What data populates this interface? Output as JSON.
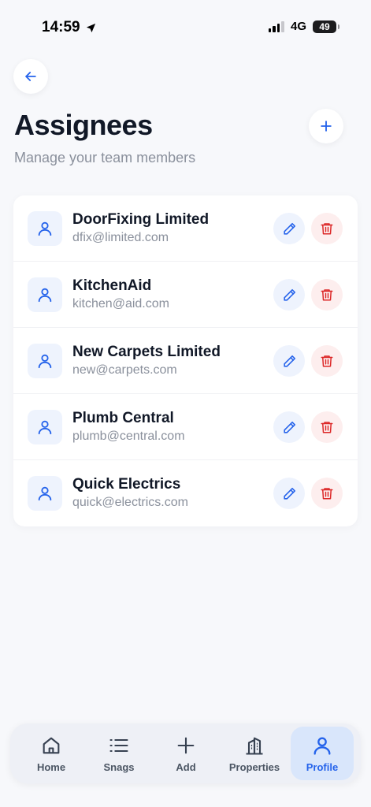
{
  "status_bar": {
    "time": "14:59",
    "network": "4G",
    "battery": "49"
  },
  "header": {
    "title": "Assignees",
    "subtitle": "Manage your team members"
  },
  "assignees": [
    {
      "name": "DoorFixing Limited",
      "email": "dfix@limited.com"
    },
    {
      "name": "KitchenAid",
      "email": "kitchen@aid.com"
    },
    {
      "name": "New Carpets Limited",
      "email": "new@carpets.com"
    },
    {
      "name": "Plumb Central",
      "email": "plumb@central.com"
    },
    {
      "name": "Quick Electrics",
      "email": "quick@electrics.com"
    }
  ],
  "tabs": [
    {
      "label": "Home",
      "icon": "home-icon"
    },
    {
      "label": "Snags",
      "icon": "list-icon"
    },
    {
      "label": "Add",
      "icon": "plus-icon"
    },
    {
      "label": "Properties",
      "icon": "building-icon"
    },
    {
      "label": "Profile",
      "icon": "user-icon",
      "active": true
    }
  ],
  "colors": {
    "accent": "#2563eb",
    "danger": "#dc2626",
    "background": "#f7f8fb",
    "muted_text": "#8a909c"
  }
}
